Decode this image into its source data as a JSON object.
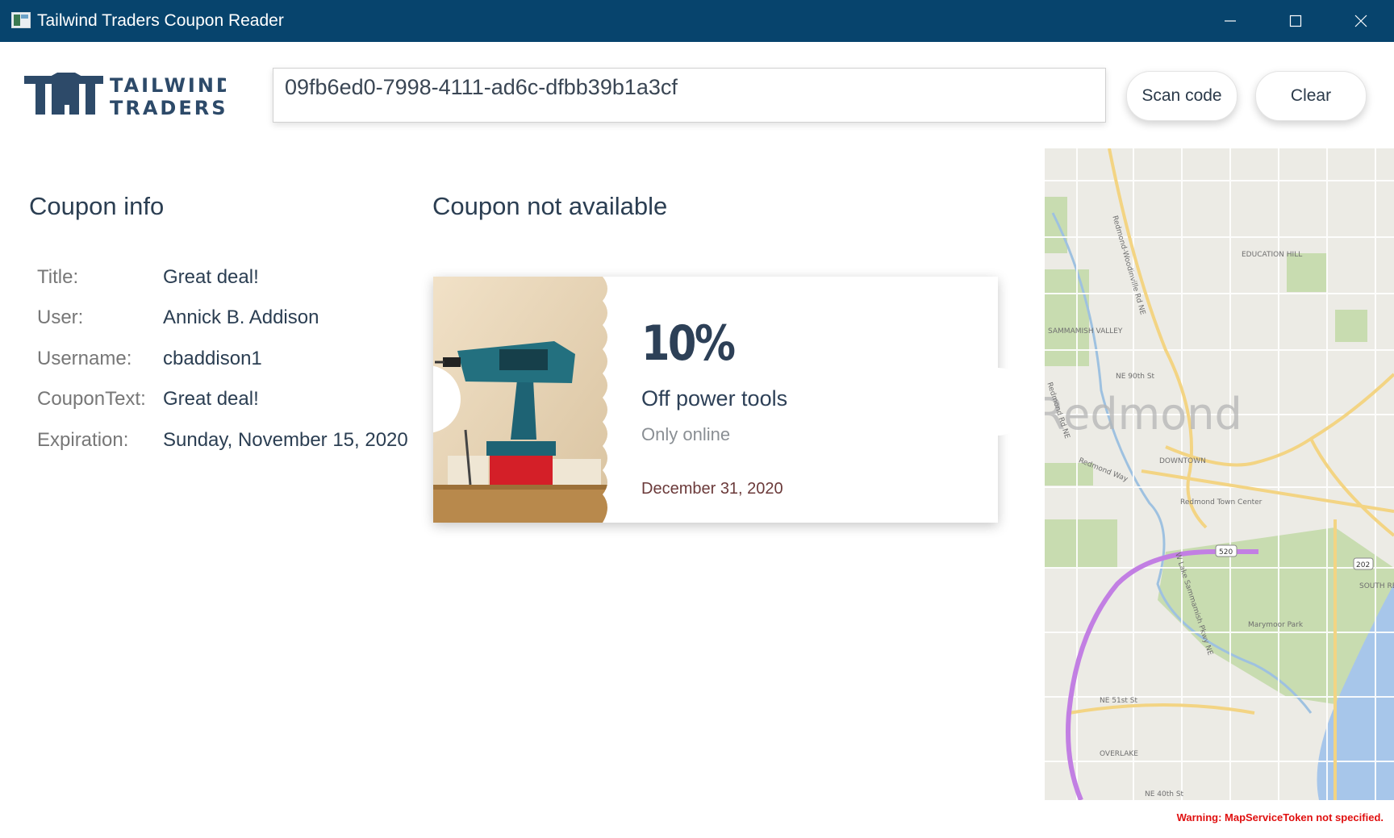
{
  "window": {
    "title": "Tailwind Traders Coupon Reader"
  },
  "brand": {
    "line1": "TAILWIND",
    "line2": "TRADERS"
  },
  "search": {
    "value": "09fb6ed0-7998-4111-ad6c-dfbb39b1a3cf"
  },
  "buttons": {
    "scan": "Scan code",
    "clear": "Clear"
  },
  "coupon_info": {
    "heading": "Coupon info",
    "rows": [
      {
        "label": "Title:",
        "value": "Great deal!"
      },
      {
        "label": "User:",
        "value": "Annick B. Addison"
      },
      {
        "label": "Username:",
        "value": "cbaddison1"
      },
      {
        "label": "CouponText:",
        "value": "Great deal!"
      },
      {
        "label": "Expiration:",
        "value": "Sunday, November 15, 2020"
      }
    ]
  },
  "coupon": {
    "status": "Coupon not available",
    "percent": "10%",
    "headline": "Off power tools",
    "subtext": "Only online",
    "expires": "December 31, 2020"
  },
  "map": {
    "city": "Redmond",
    "labels": [
      "EDUCATION HILL",
      "SAMMAMISH VALLEY",
      "NE 90th St",
      "Redmond Way",
      "DOWNTOWN",
      "Redmond Town Center",
      "520",
      "202",
      "Marymoor Park",
      "SOUTH REDMO",
      "NE 51st St",
      "OVERLAKE",
      "NE 40th St",
      "Redmond-Woodinville Rd NE",
      "W Lake Sammamish Pkwy NE",
      "Redmond Rd NE"
    ]
  },
  "warning": "Warning: MapServiceToken not specified.",
  "colors": {
    "titlebar": "#07446d",
    "text": "#2b3e52",
    "warning": "#e01010",
    "route": "#c27fe3"
  },
  "icons": {
    "minimize": "minimize-icon",
    "maximize": "maximize-icon",
    "close": "close-icon"
  }
}
